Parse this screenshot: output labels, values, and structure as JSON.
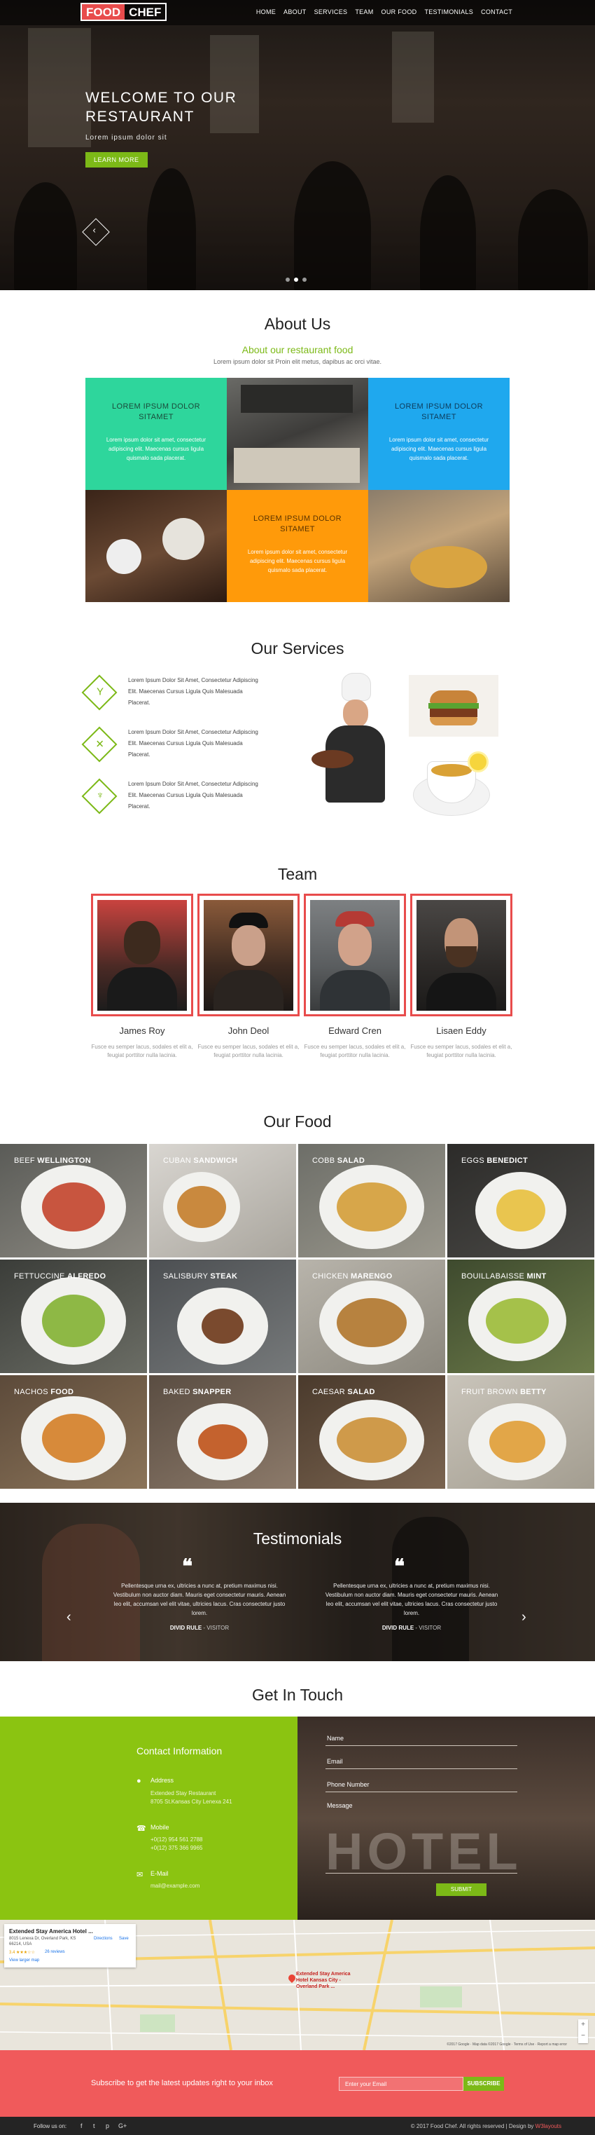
{
  "brand": {
    "part1": "FOOD",
    "part2": "CHEF"
  },
  "nav": [
    "HOME",
    "ABOUT",
    "SERVICES",
    "TEAM",
    "OUR FOOD",
    "TESTIMONIALS",
    "CONTACT"
  ],
  "hero": {
    "title": "WELCOME TO OUR RESTAURANT",
    "subtitle": "Lorem ipsum dolor sit",
    "button": "LEARN MORE",
    "slides_total": 3,
    "slide_active": 2
  },
  "about": {
    "title": "About Us",
    "subtitle": "About our restaurant food",
    "desc": "Lorem ipsum dolor sit Proin elit metus, dapibus ac orci vitae.",
    "tiles": [
      {
        "heading": "LOREM IPSUM DOLOR SITAMET",
        "text": "Lorem ipsum dolor sit amet, consectetur adipiscing elit. Maecenas cursus ligula quismalo sada placerat."
      },
      {
        "heading": "LOREM IPSUM DOLOR SITAMET",
        "text": "Lorem ipsum dolor sit amet, consectetur adipiscing elit. Maecenas cursus ligula quismalo sada placerat."
      },
      {
        "heading": "LOREM IPSUM DOLOR SITAMET",
        "text": "Lorem ipsum dolor sit amet, consectetur adipiscing elit. Maecenas cursus ligula quismalo sada placerat."
      }
    ],
    "colors": {
      "green": "#2ed69c",
      "blue": "#1fa8ee",
      "orange": "#ff9a0a"
    }
  },
  "services": {
    "title": "Our Services",
    "items": [
      {
        "icon": "cocktail-glass-icon",
        "text": "Lorem Ipsum Dolor Sit Amet, Consectetur Adipiscing Elit. Maecenas Cursus Ligula Quis Malesuada Placerat."
      },
      {
        "icon": "cutlery-icon",
        "text": "Lorem Ipsum Dolor Sit Amet, Consectetur Adipiscing Elit. Maecenas Cursus Ligula Quis Malesuada Placerat."
      },
      {
        "icon": "wine-glass-icon",
        "text": "Lorem Ipsum Dolor Sit Amet, Consectetur Adipiscing Elit. Maecenas Cursus Ligula Quis Malesuada Placerat."
      }
    ]
  },
  "team": {
    "title": "Team",
    "members": [
      {
        "name": "James Roy",
        "desc": "Fusce eu semper lacus, sodales et elit a, feugiat porttitor nulla lacinia."
      },
      {
        "name": "John Deol",
        "desc": "Fusce eu semper lacus, sodales et elit a, feugiat porttitor nulla lacinia."
      },
      {
        "name": "Edward Cren",
        "desc": "Fusce eu semper lacus, sodales et elit a, feugiat porttitor nulla lacinia."
      },
      {
        "name": "Lisaen Eddy",
        "desc": "Fusce eu semper lacus, sodales et elit a, feugiat porttitor nulla lacinia."
      }
    ]
  },
  "food": {
    "title": "Our Food",
    "items": [
      {
        "a": "BEEF",
        "b": "WELLINGTON"
      },
      {
        "a": "CUBAN",
        "b": "SANDWICH"
      },
      {
        "a": "COBB",
        "b": "SALAD"
      },
      {
        "a": "EGGS",
        "b": "BENEDICT"
      },
      {
        "a": "FETTUCCINE",
        "b": "ALFREDO"
      },
      {
        "a": "SALISBURY",
        "b": "STEAK"
      },
      {
        "a": "CHICKEN",
        "b": "MARENGO"
      },
      {
        "a": "BOUILLABAISSE",
        "b": "MINT"
      },
      {
        "a": "NACHOS",
        "b": "FOOD"
      },
      {
        "a": "BAKED",
        "b": "SNAPPER"
      },
      {
        "a": "CAESAR",
        "b": "SALAD"
      },
      {
        "a": "FRUIT BROWN",
        "b": "BETTY"
      }
    ]
  },
  "testimonials": {
    "title": "Testimonials",
    "items": [
      {
        "text": "Pellentesque urna ex, ultricies a nunc at, pretium maximus nisi. Vestibulum non auctor diam. Mauris eget consectetur mauris. Aenean leo elit, accumsan vel elit vitae, ultricies lacus. Cras consectetur justo lorem.",
        "name": "DIVID RULE",
        "role": " - VISITOR"
      },
      {
        "text": "Pellentesque urna ex, ultricies a nunc at, pretium maximus nisi. Vestibulum non auctor diam. Mauris eget consectetur mauris. Aenean leo elit, accumsan vel elit vitae, ultricies lacus. Cras consectetur justo lorem.",
        "name": "DIVID RULE",
        "role": " - VISITOR"
      }
    ]
  },
  "contact": {
    "title": "Get In Touch",
    "info_title": "Contact Information",
    "address_label": "Address",
    "address_lines": [
      "Extended Stay Restaurant",
      "8705 St.Kansas City Lenexa 241"
    ],
    "mobile_label": "Mobile",
    "mobile_lines": [
      "+0(12) 954 561 2788",
      "+0(12) 375 366 9965"
    ],
    "email_label": "E-Mail",
    "email": "mail@example.com",
    "fields": [
      "Name",
      "Email",
      "Phone Number"
    ],
    "message": "Message",
    "submit": "SUBMIT",
    "sign": "HOTEL"
  },
  "map": {
    "place": "Extended Stay America Hotel ...",
    "address": "8015 Lenexa Dr, Overland Park, KS 66214, USA",
    "rating": "3.4 ★★★☆☆",
    "reviews": "26 reviews",
    "larger": "View larger map",
    "directions": "Directions",
    "save": "Save",
    "pin_label": "Extended Stay America Hotel Kansas City - Overland Park ...",
    "copyright": "©2017 Google · Map data ©2017 Google · Terms of Use · Report a map error"
  },
  "subscribe": {
    "text": "Subscribe to get the latest updates right to your inbox",
    "placeholder": "Enter your Email",
    "button": "SUBSCRIBE"
  },
  "footer": {
    "follow": "Follow us on:",
    "social": [
      "f",
      "t",
      "p",
      "G+"
    ],
    "copyright": "© 2017 Food Chef. All rights reserved | Design by ",
    "designer": "W3layouts"
  }
}
